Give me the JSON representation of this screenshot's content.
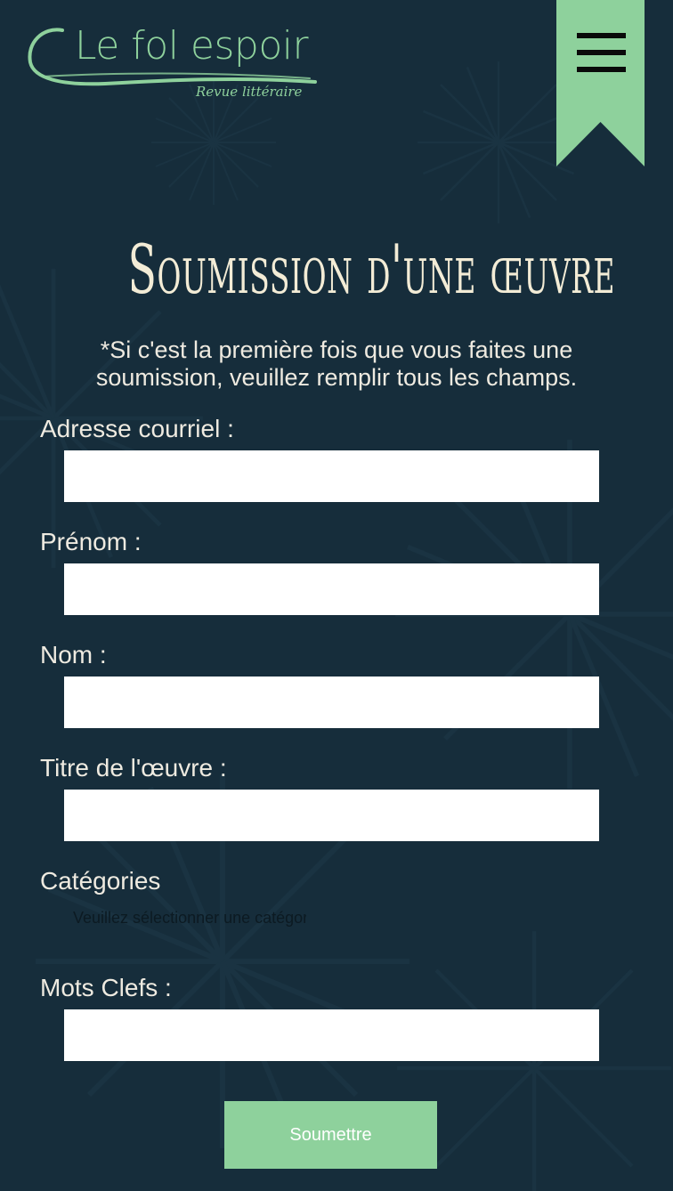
{
  "header": {
    "logo_title": "Le fol espoir",
    "logo_subtitle": "Revue littéraire",
    "menu_icon": "hamburger-menu-icon"
  },
  "page": {
    "title": "Soumission d'une œuvre",
    "notice": "*Si c'est la première fois que vous faites une soumission, veuillez remplir tous les champs."
  },
  "form": {
    "email_label": "Adresse courriel :",
    "email_value": "",
    "firstname_label": "Prénom :",
    "firstname_value": "",
    "lastname_label": "Nom :",
    "lastname_value": "",
    "work_title_label": "Titre de l'œuvre :",
    "work_title_value": "",
    "categories_label": "Catégories",
    "categories_selected": "Veuillez sélectionner une catégorie",
    "keywords_label": "Mots Clefs :",
    "keywords_value": "",
    "submit_label": "Soumettre"
  },
  "colors": {
    "background": "#162d3b",
    "accent": "#8ed19c",
    "title_text": "#f3ecd6",
    "body_text": "#eeeae0"
  }
}
